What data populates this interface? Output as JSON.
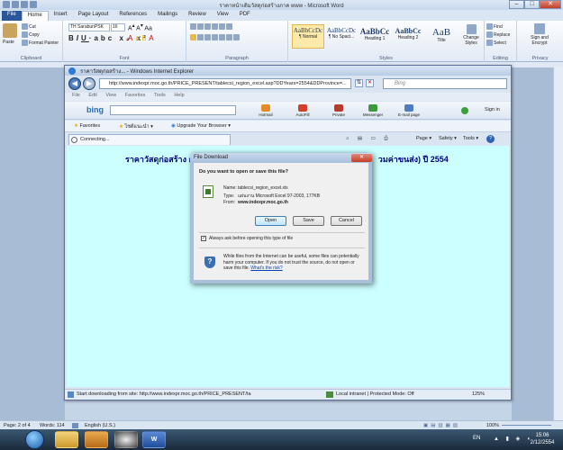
{
  "word": {
    "title": "ราคาหน้าเดิมวัสดุก่อสร้างภาค www - Microsoft Word",
    "tabs": [
      "File",
      "Home",
      "Insert",
      "Page Layout",
      "References",
      "Mailings",
      "Review",
      "View",
      "PDF"
    ],
    "clipboard": {
      "paste": "Paste",
      "cut": "Cut",
      "copy": "Copy",
      "format_painter": "Format Painter",
      "label": "Clipboard"
    },
    "font": {
      "name": "TH SarabunPSK",
      "size": "16",
      "label": "Font"
    },
    "paragraph_label": "Paragraph",
    "styles": [
      {
        "preview": "AaBbCcDc",
        "name": "¶ Normal"
      },
      {
        "preview": "AaBbCcDc",
        "name": "¶ No Spaci..."
      },
      {
        "preview": "AaBbCc",
        "name": "Heading 1"
      },
      {
        "preview": "AaBbCc",
        "name": "Heading 2"
      },
      {
        "preview": "AaB",
        "name": "Title"
      }
    ],
    "change_styles": "Change Styles",
    "styles_label": "Styles",
    "editing": {
      "find": "Find",
      "replace": "Replace",
      "select": "Select",
      "label": "Editing"
    },
    "privacy": {
      "sign": "Sign and Encrypt",
      "label": "Privacy"
    },
    "status": {
      "page": "Page: 2 of 4",
      "words": "Words: 114",
      "language": "English (U.S.)",
      "zoom": "100%"
    }
  },
  "ie": {
    "title": "ราคาวัสดุก่อสร้าง... - Windows Internet Explorer",
    "url": "http://www.indexpr.moc.go.th/PRICE_PRESENT/tablecsi_region_excel.asp?DDYears=2554&DDProvince=...",
    "search_placeholder": "Bing",
    "menu": [
      "File",
      "Edit",
      "View",
      "Favorites",
      "Tools",
      "Help"
    ],
    "bing_label": "bing",
    "bing_buttons": [
      "Hotmail",
      "AutoFill",
      "Private",
      "Messenger",
      "E-mail page"
    ],
    "sign_in": "Sign in",
    "favorites": "Favorites",
    "fav_items": [
      "ไซต์แนะนำ ▾",
      "Upgrade Your Browser ▾"
    ],
    "tab_label": "Connecting...",
    "cmd": [
      "Page ▾",
      "Safety ▾",
      "Tools ▾"
    ],
    "page_heading_left": "ราคาวัสดุก่อสร้าง กร",
    "page_heading_right": "วมค่าขนส่ง) ปี 2554",
    "status_text": "Start downloading from site: http://www.indexpr.moc.go.th/PRICE_PRESENT/ta",
    "zone": "Local intranet | Protected Mode: Off",
    "zoom": "125%"
  },
  "dialog": {
    "title": "File Download",
    "question": "Do you want to open or save this file?",
    "name_label": "Name:",
    "name": "tablecsi_region_excel.xls",
    "type_label": "Type:",
    "type": "แผ่นงาน Microsoft Excel 97-2003, 177KB",
    "from_label": "From:",
    "from": "www.indexpr.moc.go.th",
    "open": "Open",
    "save": "Save",
    "cancel": "Cancel",
    "checkbox": "Always ask before opening this type of file",
    "warning": "While files from the Internet can be useful, some files can potentially harm your computer. If you do not trust the source, do not open or save this file.",
    "risk_link": "What's the risk?"
  },
  "taskbar": {
    "lang": "EN",
    "time": "15:06",
    "date": "2/12/2554"
  }
}
